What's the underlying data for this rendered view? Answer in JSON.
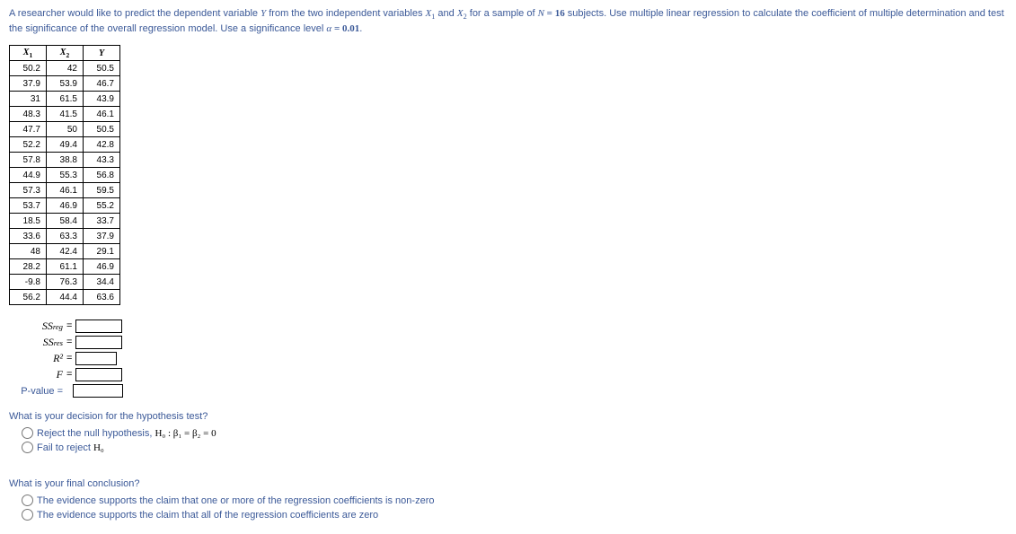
{
  "intro": {
    "pre": "A researcher would like to predict the dependent variable ",
    "Y": "Y",
    "mid1": " from the two independent variables ",
    "X1": "X",
    "X1sub": "1",
    "and": " and ",
    "X2": "X",
    "X2sub": "2",
    "mid2": " for a sample of ",
    "Nlab": "N",
    "eq1": " = ",
    "Nval": "16",
    "mid3": " subjects. Use multiple linear regression to calculate the coefficient of multiple determination and test the significance of the overall regression model. Use a significance level ",
    "alpha": "α",
    "eq2": " = ",
    "alphaval": "0.01",
    "end": "."
  },
  "table": {
    "headers": {
      "h1": "X",
      "h1s": "1",
      "h2": "X",
      "h2s": "2",
      "h3": "Y"
    },
    "rows": [
      [
        "50.2",
        "42",
        "50.5"
      ],
      [
        "37.9",
        "53.9",
        "46.7"
      ],
      [
        "31",
        "61.5",
        "43.9"
      ],
      [
        "48.3",
        "41.5",
        "46.1"
      ],
      [
        "47.7",
        "50",
        "50.5"
      ],
      [
        "52.2",
        "49.4",
        "42.8"
      ],
      [
        "57.8",
        "38.8",
        "43.3"
      ],
      [
        "44.9",
        "55.3",
        "56.8"
      ],
      [
        "57.3",
        "46.1",
        "59.5"
      ],
      [
        "53.7",
        "46.9",
        "55.2"
      ],
      [
        "18.5",
        "58.4",
        "33.7"
      ],
      [
        "33.6",
        "63.3",
        "37.9"
      ],
      [
        "48",
        "42.4",
        "29.1"
      ],
      [
        "28.2",
        "61.1",
        "46.9"
      ],
      [
        "-9.8",
        "76.3",
        "34.4"
      ],
      [
        "56.2",
        "44.4",
        "63.6"
      ]
    ]
  },
  "answers": {
    "ssreg_l": "SS",
    "ssreg_s": "reg",
    "ssres_l": "SS",
    "ssres_s": "res",
    "r2": "R²",
    "F": "F",
    "pval": "P-value ="
  },
  "q1": {
    "prompt": "What is your decision for the hypothesis test?",
    "opt1_pre": "Reject the null hypothesis, ",
    "opt1_math": "H₀ : β₁ = β₂ = 0",
    "opt2_pre": "Fail to reject ",
    "opt2_math": "H₀"
  },
  "q2": {
    "prompt": "What is your final conclusion?",
    "opt1": "The evidence supports the claim that one or more of the regression coefficients is non-zero",
    "opt2": "The evidence supports the claim that all of the regression coefficients are zero"
  }
}
